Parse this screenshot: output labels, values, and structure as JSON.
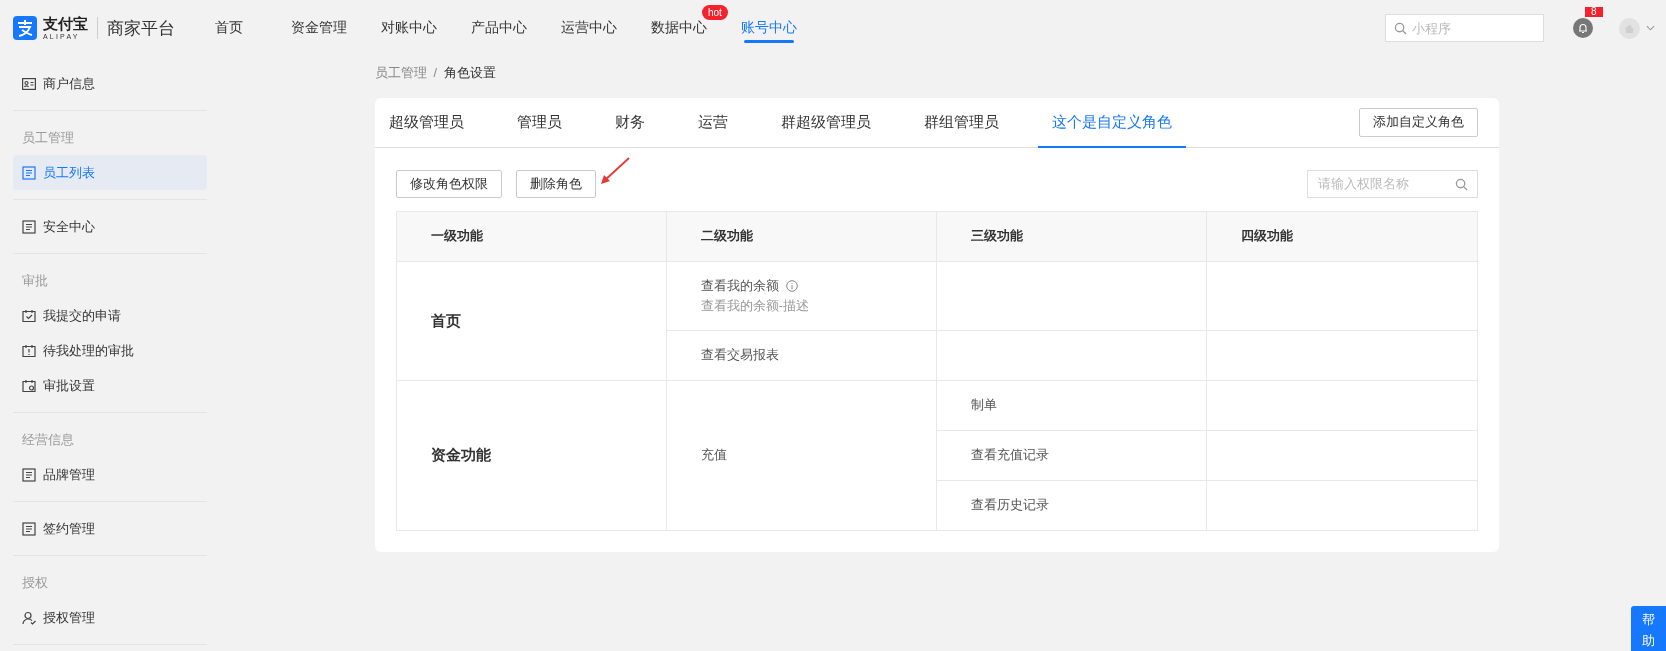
{
  "header": {
    "logo": {
      "name": "支付宝",
      "subtitle": "ALIPAY"
    },
    "platform": "商家平台",
    "nav": [
      {
        "label": "首页",
        "selected": false
      },
      {
        "label": "资金管理",
        "selected": false
      },
      {
        "label": "对账中心",
        "selected": false
      },
      {
        "label": "产品中心",
        "selected": false
      },
      {
        "label": "运营中心",
        "selected": false
      },
      {
        "label": "数据中心",
        "selected": false,
        "badge": "hot"
      },
      {
        "label": "账号中心",
        "selected": true
      }
    ],
    "search": {
      "placeholder": "小程序"
    },
    "notifications": {
      "count": "8"
    }
  },
  "sidebar": {
    "sections": [
      {
        "items": [
          {
            "label": "商户信息",
            "selected": false
          }
        ]
      },
      {
        "label": "员工管理",
        "items": [
          {
            "label": "员工列表",
            "selected": true
          }
        ]
      },
      {
        "items": [
          {
            "label": "安全中心",
            "selected": false
          }
        ]
      },
      {
        "label": "审批",
        "items": [
          {
            "label": "我提交的申请",
            "selected": false
          },
          {
            "label": "待我处理的审批",
            "selected": false
          },
          {
            "label": "审批设置",
            "selected": false
          }
        ]
      },
      {
        "label": "经营信息",
        "items": [
          {
            "label": "品牌管理",
            "selected": false
          }
        ]
      },
      {
        "items": [
          {
            "label": "签约管理",
            "selected": false
          }
        ]
      },
      {
        "label": "授权",
        "items": [
          {
            "label": "授权管理",
            "selected": false
          }
        ]
      }
    ]
  },
  "breadcrumb": {
    "items": [
      "员工管理",
      "角色设置"
    ],
    "separator": "/"
  },
  "tabs": [
    {
      "label": "超级管理员",
      "selected": false
    },
    {
      "label": "管理员",
      "selected": false
    },
    {
      "label": "财务",
      "selected": false
    },
    {
      "label": "运营",
      "selected": false
    },
    {
      "label": "群超级管理员",
      "selected": false
    },
    {
      "label": "群组管理员",
      "selected": false
    },
    {
      "label": "这个是自定义角色",
      "selected": true
    }
  ],
  "add_button": "添加自定义角色",
  "toolbar": {
    "buttons": [
      "修改角色权限",
      "删除角色"
    ],
    "search": {
      "placeholder": "请输入权限名称"
    }
  },
  "table": {
    "columns": [
      "一级功能",
      "二级功能",
      "三级功能",
      "四级功能"
    ],
    "groups": [
      {
        "label": "首页",
        "children": [
          {
            "label": "查看我的余额",
            "info": true,
            "description": "查看我的余额-描述"
          },
          {
            "label": "查看交易报表",
            "info": false
          }
        ]
      },
      {
        "label": "资金功能",
        "children": [
          {
            "label": "充值",
            "info": false,
            "children": [
              {
                "label": "制单"
              },
              {
                "label": "查看充值记录"
              },
              {
                "label": "查看历史记录"
              }
            ]
          }
        ]
      }
    ]
  },
  "help_button": {
    "label": "帮助"
  }
}
